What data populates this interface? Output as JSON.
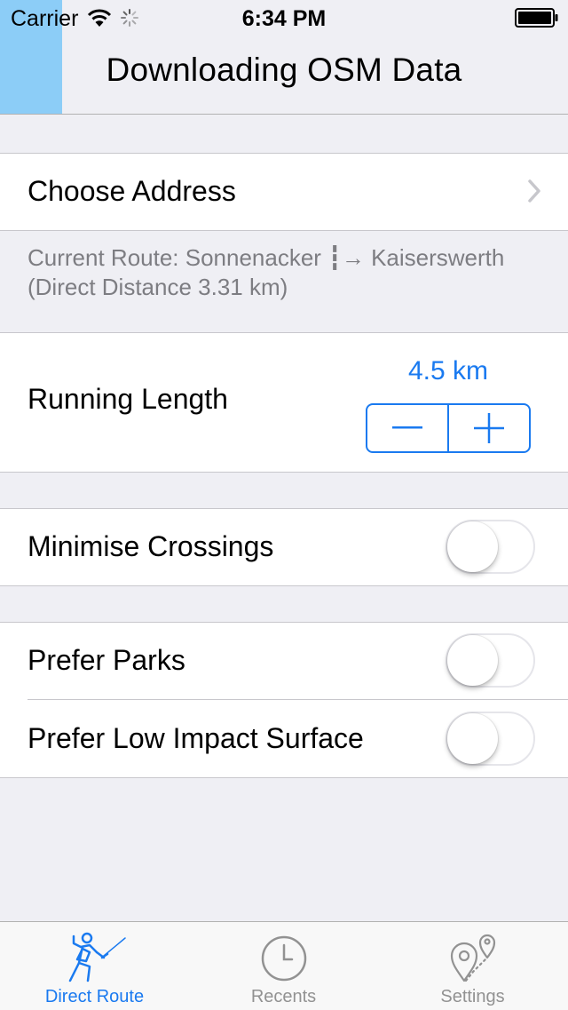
{
  "status_bar": {
    "carrier": "Carrier",
    "time": "6:34 PM",
    "icons": [
      "wifi-icon",
      "activity-icon",
      "battery-icon"
    ]
  },
  "nav": {
    "title": "Downloading OSM Data",
    "progress_fraction": 0.11,
    "progress_color": "#8ccdf7"
  },
  "address": {
    "label": "Choose Address",
    "route_line1": "Current Route: Sonnenacker ┇→ Kaiserswerth",
    "route_line2": "(Direct Distance 3.31 km)"
  },
  "running_length": {
    "label": "Running Length",
    "value": "4.5 km",
    "stepper_icons": [
      "minus-icon",
      "plus-icon"
    ]
  },
  "options": {
    "minimise_crossings": {
      "label": "Minimise Crossings",
      "on": false
    },
    "prefer_parks": {
      "label": "Prefer Parks",
      "on": false
    },
    "prefer_low_impact": {
      "label": "Prefer Low Impact Surface",
      "on": false
    }
  },
  "tabs": [
    {
      "label": "Direct Route",
      "icon": "runner-icon",
      "active": true
    },
    {
      "label": "Recents",
      "icon": "clock-icon",
      "active": false
    },
    {
      "label": "Settings",
      "icon": "map-pins-icon",
      "active": false
    }
  ],
  "colors": {
    "accent": "#1a7af0",
    "background": "#efeff4",
    "secondary_text": "#7d7d82"
  }
}
